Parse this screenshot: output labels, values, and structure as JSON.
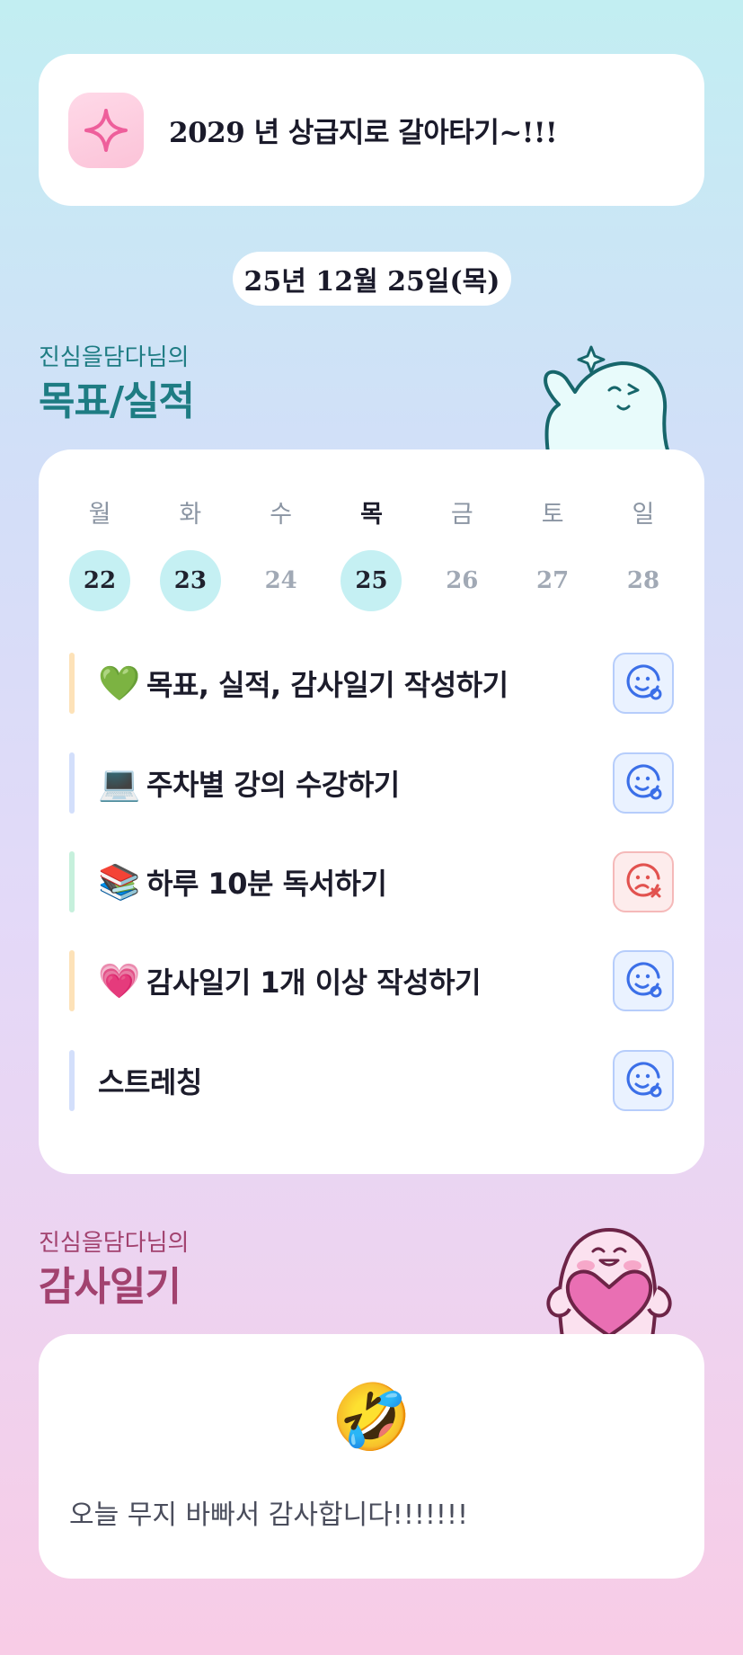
{
  "motto": {
    "icon": "sparkle-icon",
    "text": "2029 년 상급지로 갈아타기~!!!"
  },
  "date": "25년 12월 25일(목)",
  "goals_section": {
    "subtitle": "진심을담다님의",
    "title": "목표/실적"
  },
  "week": {
    "days": [
      "월",
      "화",
      "수",
      "목",
      "금",
      "토",
      "일"
    ],
    "dates": [
      "22",
      "23",
      "24",
      "25",
      "26",
      "27",
      "28"
    ],
    "today_index": 3,
    "done_dates": [
      "22",
      "23",
      "25"
    ]
  },
  "tasks": [
    {
      "emoji": "💚",
      "label": "목표, 실적, 감사일기 작성하기",
      "bar_color": "#fde2b8",
      "status": "done"
    },
    {
      "emoji": "💻",
      "label": "주차별 강의 수강하기",
      "bar_color": "#d3dffb",
      "status": "done"
    },
    {
      "emoji": "📚",
      "label": "하루 10분 독서하기",
      "bar_color": "#c6f0dc",
      "status": "failed"
    },
    {
      "emoji": "💗",
      "label": "감사일기 1개 이상 작성하기",
      "bar_color": "#fde2b8",
      "status": "done"
    },
    {
      "emoji": "",
      "label": "스트레칭",
      "bar_color": "#d3dffb",
      "status": "done"
    }
  ],
  "gratitude_section": {
    "subtitle": "진심을담다님의",
    "title": "감사일기"
  },
  "gratitude": {
    "emoji": "🤣",
    "text": "오늘 무지 바빠서 감사합니다!!!!!!!"
  },
  "colors": {
    "accent_teal": "#1e7c83",
    "accent_plum": "#a2426f",
    "done_blue": "#3b6fe8",
    "fail_red": "#e2524f",
    "done_circle": "#c5f0f3"
  }
}
